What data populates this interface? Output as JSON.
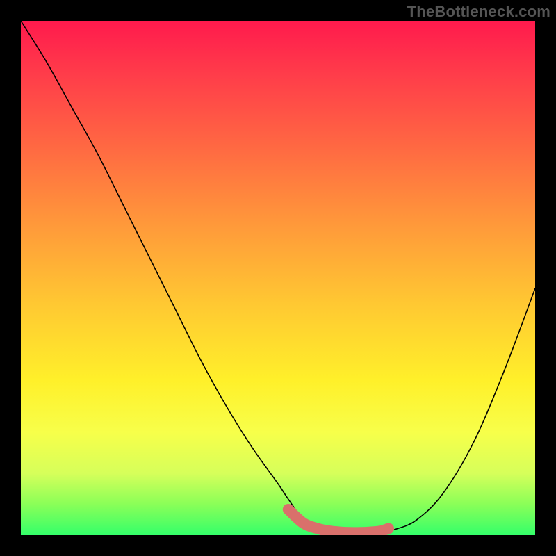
{
  "watermark": "TheBottleneck.com",
  "chart_data": {
    "type": "line",
    "title": "",
    "xlabel": "",
    "ylabel": "",
    "xlim": [
      0,
      100
    ],
    "ylim": [
      0,
      100
    ],
    "grid": false,
    "series": [
      {
        "name": "curve-main",
        "color": "#000000",
        "x": [
          0,
          5,
          10,
          15,
          20,
          25,
          30,
          35,
          40,
          45,
          50,
          52,
          55,
          58,
          61,
          64,
          67,
          70,
          73,
          77,
          82,
          88,
          94,
          100
        ],
        "values": [
          100,
          92,
          83,
          74,
          64,
          54,
          44,
          34,
          25,
          17,
          10,
          7,
          3,
          1.5,
          0.7,
          0.5,
          0.5,
          0.7,
          1.2,
          3,
          8,
          18,
          32,
          48
        ]
      },
      {
        "name": "marker-band",
        "color": "#d9706b",
        "stroke_width": 16,
        "x": [
          52,
          55,
          58,
          60,
          62,
          64,
          66,
          68,
          70,
          71.5
        ],
        "values": [
          5,
          2.3,
          1.2,
          0.8,
          0.6,
          0.5,
          0.5,
          0.6,
          0.8,
          1.3
        ]
      }
    ]
  }
}
